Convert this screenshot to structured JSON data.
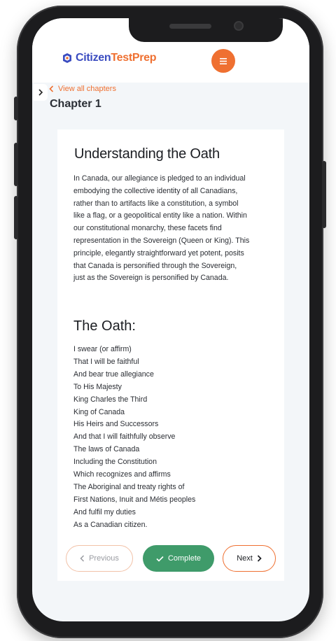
{
  "header": {
    "logo_part1": "Citizen",
    "logo_part2": "TestPrep",
    "menu_icon": "hamburger-icon"
  },
  "nav": {
    "sidebar_toggle_icon": "chevron-right-icon",
    "view_all_label": "View all chapters",
    "chapter_title": "Chapter 1"
  },
  "content": {
    "title": "Understanding the Oath",
    "paragraph_lines": [
      "In Canada, our allegiance is pledged to an individual",
      "embodying the collective identity of all Canadians,",
      "rather than to artifacts like a constitution, a symbol",
      "like a flag, or a geopolitical entity like a nation. Within",
      "our constitutional monarchy, these facets find",
      "representation in the Sovereign (Queen or King). This",
      "principle, elegantly straightforward yet potent, posits",
      "that Canada is personified through the Sovereign,",
      "just as the Sovereign is personified by Canada."
    ],
    "oath_title": "The Oath:",
    "oath_lines": [
      "I swear (or affirm)",
      "That I will be faithful",
      "And bear true allegiance",
      "To His Majesty",
      "King Charles the Third",
      "King of Canada",
      "His Heirs and Successors",
      "And that I will faithfully observe",
      "The laws of Canada",
      "Including the Constitution",
      "Which recognizes and affirms",
      "The Aboriginal and treaty rights of",
      "First Nations, Inuit and Métis peoples",
      "And fulfil my duties",
      "As a Canadian citizen."
    ]
  },
  "footer": {
    "previous_label": "Previous",
    "complete_label": "Complete",
    "next_label": "Next"
  },
  "colors": {
    "brand_blue": "#3b4cc0",
    "brand_orange": "#ef7031",
    "complete_green": "#3f9b6a"
  }
}
